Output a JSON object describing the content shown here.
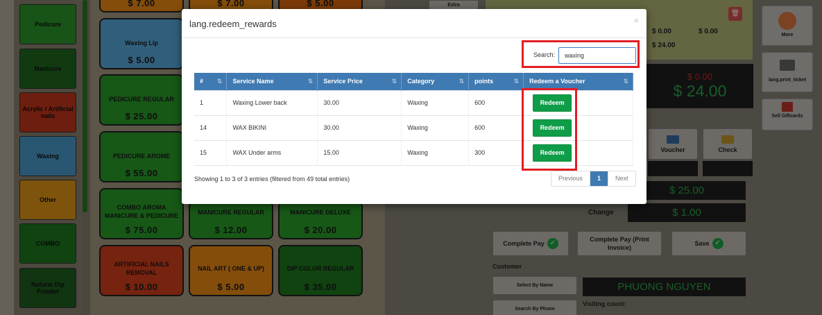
{
  "categories": [
    {
      "label": "Pedicure",
      "color": "#2d9a2d"
    },
    {
      "label": "Manicure",
      "color": "#1f6b1f"
    },
    {
      "label": "Acrylic / Artificial nails",
      "color": "#c9381a"
    },
    {
      "label": "Waxing",
      "color": "#4b9fd0"
    },
    {
      "label": "Other",
      "color": "#e59a18"
    },
    {
      "label": "COMBO",
      "color": "#1e7a1e"
    },
    {
      "label": "Natural Dip Powder",
      "color": "#1f5f1f"
    }
  ],
  "services": [
    {
      "name": "",
      "price": "$ 7.00",
      "color": "#f08c14"
    },
    {
      "name": "",
      "price": "$ 7.00",
      "color": "#f08c14"
    },
    {
      "name": "",
      "price": "$ 5.00",
      "color": "#e06a10"
    },
    {
      "name": "Waxing Lip",
      "price": "$ 5.00",
      "color": "#5aaee0"
    },
    {
      "name": "PEDICURE REGULAR",
      "price": "$ 25.00",
      "color": "#2aa02a"
    },
    {
      "name": "PEDICURE AROME",
      "price": "$ 55.00",
      "color": "#2aa02a"
    },
    {
      "name": "COMBO AROMA MANICURE & PEDICURE",
      "price": "$ 75.00",
      "color": "#2aa02a"
    },
    {
      "name": "MANICURE REGULAR",
      "price": "$ 12.00",
      "color": "#2aa02a"
    },
    {
      "name": "MANICURE DELUXE",
      "price": "$ 20.00",
      "color": "#2aa02a"
    },
    {
      "name": "ARTIFICIAL NAILS REMOVAL",
      "price": "$ 10.00",
      "color": "#d8401c"
    },
    {
      "name": "NAIL ART ( ONE & UP)",
      "price": "$ 5.00",
      "color": "#f08c14"
    },
    {
      "name": "DIP COLOR REGULAR",
      "price": "$ 35.00",
      "color": "#1e7a1e"
    }
  ],
  "pos": {
    "extra_label": "Extra",
    "amount_a": "$ 0.00",
    "amount_b": "$ 0.00",
    "amount_c": "$ 24.00",
    "due_red": "$ 0.00",
    "total": "$ 24.00",
    "voucher_label": "Voucher",
    "check_label": "Check",
    "paid": "$ 25.00",
    "change_label": "Change",
    "change": "$ 1.00",
    "complete_pay": "Complete Pay",
    "complete_pay_print": "Complete Pay (Print Invoice)",
    "save": "Save",
    "customer_label": "Customer",
    "select_by_name": "Select By Name",
    "search_by_phone": "Search By Phone",
    "customer_name": "PHUONG NGUYEN",
    "visiting_count": "Visiting count:",
    "side_more": "More",
    "side_print": "lang.print_ticket",
    "side_gift": "Sell Giftcards"
  },
  "modal": {
    "title": "lang.redeem_rewards",
    "close": "×",
    "search_label": "Search:",
    "search_value": "waxing",
    "columns": [
      "#",
      "Service Name",
      "Service Price",
      "Category",
      "points",
      "Redeem a Voucher"
    ],
    "rows": [
      {
        "id": "1",
        "name": "Waxing Lower back",
        "price": "30.00",
        "category": "Waxing",
        "points": "600",
        "action": "Redeem"
      },
      {
        "id": "14",
        "name": "WAX BIKINI",
        "price": "30.00",
        "category": "Waxing",
        "points": "600",
        "action": "Redeem"
      },
      {
        "id": "15",
        "name": "WAX Under arms",
        "price": "15.00",
        "category": "Waxing",
        "points": "300",
        "action": "Redeem"
      }
    ],
    "info": "Showing 1 to 3 of 3 entries (filtered from 49 total entries)",
    "pager": {
      "prev": "Previous",
      "page": "1",
      "next": "Next"
    }
  }
}
